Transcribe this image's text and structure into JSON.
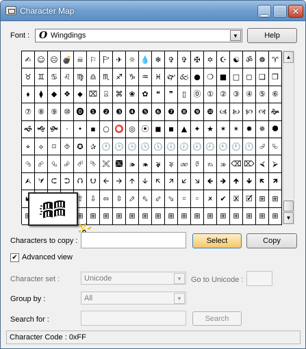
{
  "window": {
    "title": "Character Map"
  },
  "caption_buttons": {
    "minimize": "▁",
    "maximize": "□",
    "close": "✕"
  },
  "font": {
    "label": "Font :",
    "value": "Wingdings",
    "icon": "O",
    "help_label": "Help"
  },
  "grid_chars": [
    "✍",
    "☺",
    "☹",
    "💣",
    "☠",
    "⚐",
    "🏱",
    "✈",
    "☼",
    "💧",
    "❄",
    "✞",
    "✞",
    "✠",
    "✡",
    "☪",
    "☯",
    "ॐ",
    "☸",
    "♈",
    "♉",
    "♊",
    "♋",
    "♌",
    "♍",
    "♎",
    "♏",
    "♐",
    "♑",
    "♒",
    "♓",
    "🙰",
    "🙵",
    "●",
    "❍",
    "■",
    "□",
    "◻",
    "❑",
    "❒",
    "⬧",
    "⧫",
    "◆",
    "❖",
    "⬥",
    "⌧",
    "⍓",
    "⌘",
    "❀",
    "✿",
    "❝",
    "❞",
    "▯",
    "⓪",
    "①",
    "②",
    "③",
    "④",
    "⑤",
    "⑥",
    "⑦",
    "⑧",
    "⑨",
    "⑩",
    "⓿",
    "❶",
    "❷",
    "❸",
    "❹",
    "❺",
    "❻",
    "❼",
    "❽",
    "❾",
    "❿",
    "🙢",
    "🙠",
    "🙡",
    "🙣",
    "🙞",
    "🙜",
    "🙝",
    "🙟",
    "·",
    "•",
    "▪",
    "○",
    "⭕",
    "◎",
    "⦿",
    "◼",
    "◾",
    "▲",
    "✦",
    "★",
    "✶",
    "✴",
    "✹",
    "✵",
    "⯃",
    "⌖",
    "⟡",
    "⌑",
    "⯑",
    "✪",
    "✰",
    "🕐",
    "🕑",
    "🕒",
    "🕓",
    "🕔",
    "🕕",
    "🕖",
    "🕗",
    "🕘",
    "🕙",
    "🕚",
    "🕛",
    "⮰",
    "⮱",
    "⮲",
    "⮳",
    "⮴",
    "⮵",
    "⮶",
    "⮷",
    "🙪",
    "🙫",
    "🙕",
    "🙔",
    "🙗",
    "🙖",
    "🙐",
    "🙑",
    "🙒",
    "🙓",
    "⌫",
    "⌦",
    "⮘",
    "⮚",
    "⮙",
    "⮛",
    "⮈",
    "⮊",
    "⮉",
    "⮋",
    "🡨",
    "🡪",
    "🡩",
    "🡫",
    "🡬",
    "🡭",
    "🡯",
    "🡮",
    "🡸",
    "🡺",
    "🡹",
    "🡻",
    "🡼",
    "🡽",
    "🡿",
    "🡾",
    "⇦",
    "⇨",
    "⇧",
    "⇩",
    "⬄",
    "⇳",
    "⬀",
    "⬁",
    "⬃",
    "⬂",
    "🢬",
    "🢭",
    "🗶",
    "✔",
    "🗷",
    "🗹",
    "⊞",
    "⊞",
    "⊞",
    "⊞",
    "⊞",
    "⊞",
    "⊞",
    "⊞",
    "⊞",
    "⊞",
    "⊞",
    "⊞",
    "⊞",
    "⊞",
    "⊞",
    "⊞",
    "⊞",
    "⊞",
    "⊞",
    "⊞",
    "⊞",
    "⊞"
  ],
  "copy": {
    "label": "Characters to copy :",
    "value": "",
    "select_label": "Select",
    "copy_label": "Copy"
  },
  "advanced": {
    "label": "Advanced view",
    "checked": "✔"
  },
  "charset": {
    "label": "Character set :",
    "value": "Unicode",
    "goto_label": "Go to Unicode :"
  },
  "groupby": {
    "label": "Group by :",
    "value": "All"
  },
  "search": {
    "label": "Search for :",
    "search_label": "Search"
  },
  "status": {
    "text": "Character Code : 0xFF"
  }
}
